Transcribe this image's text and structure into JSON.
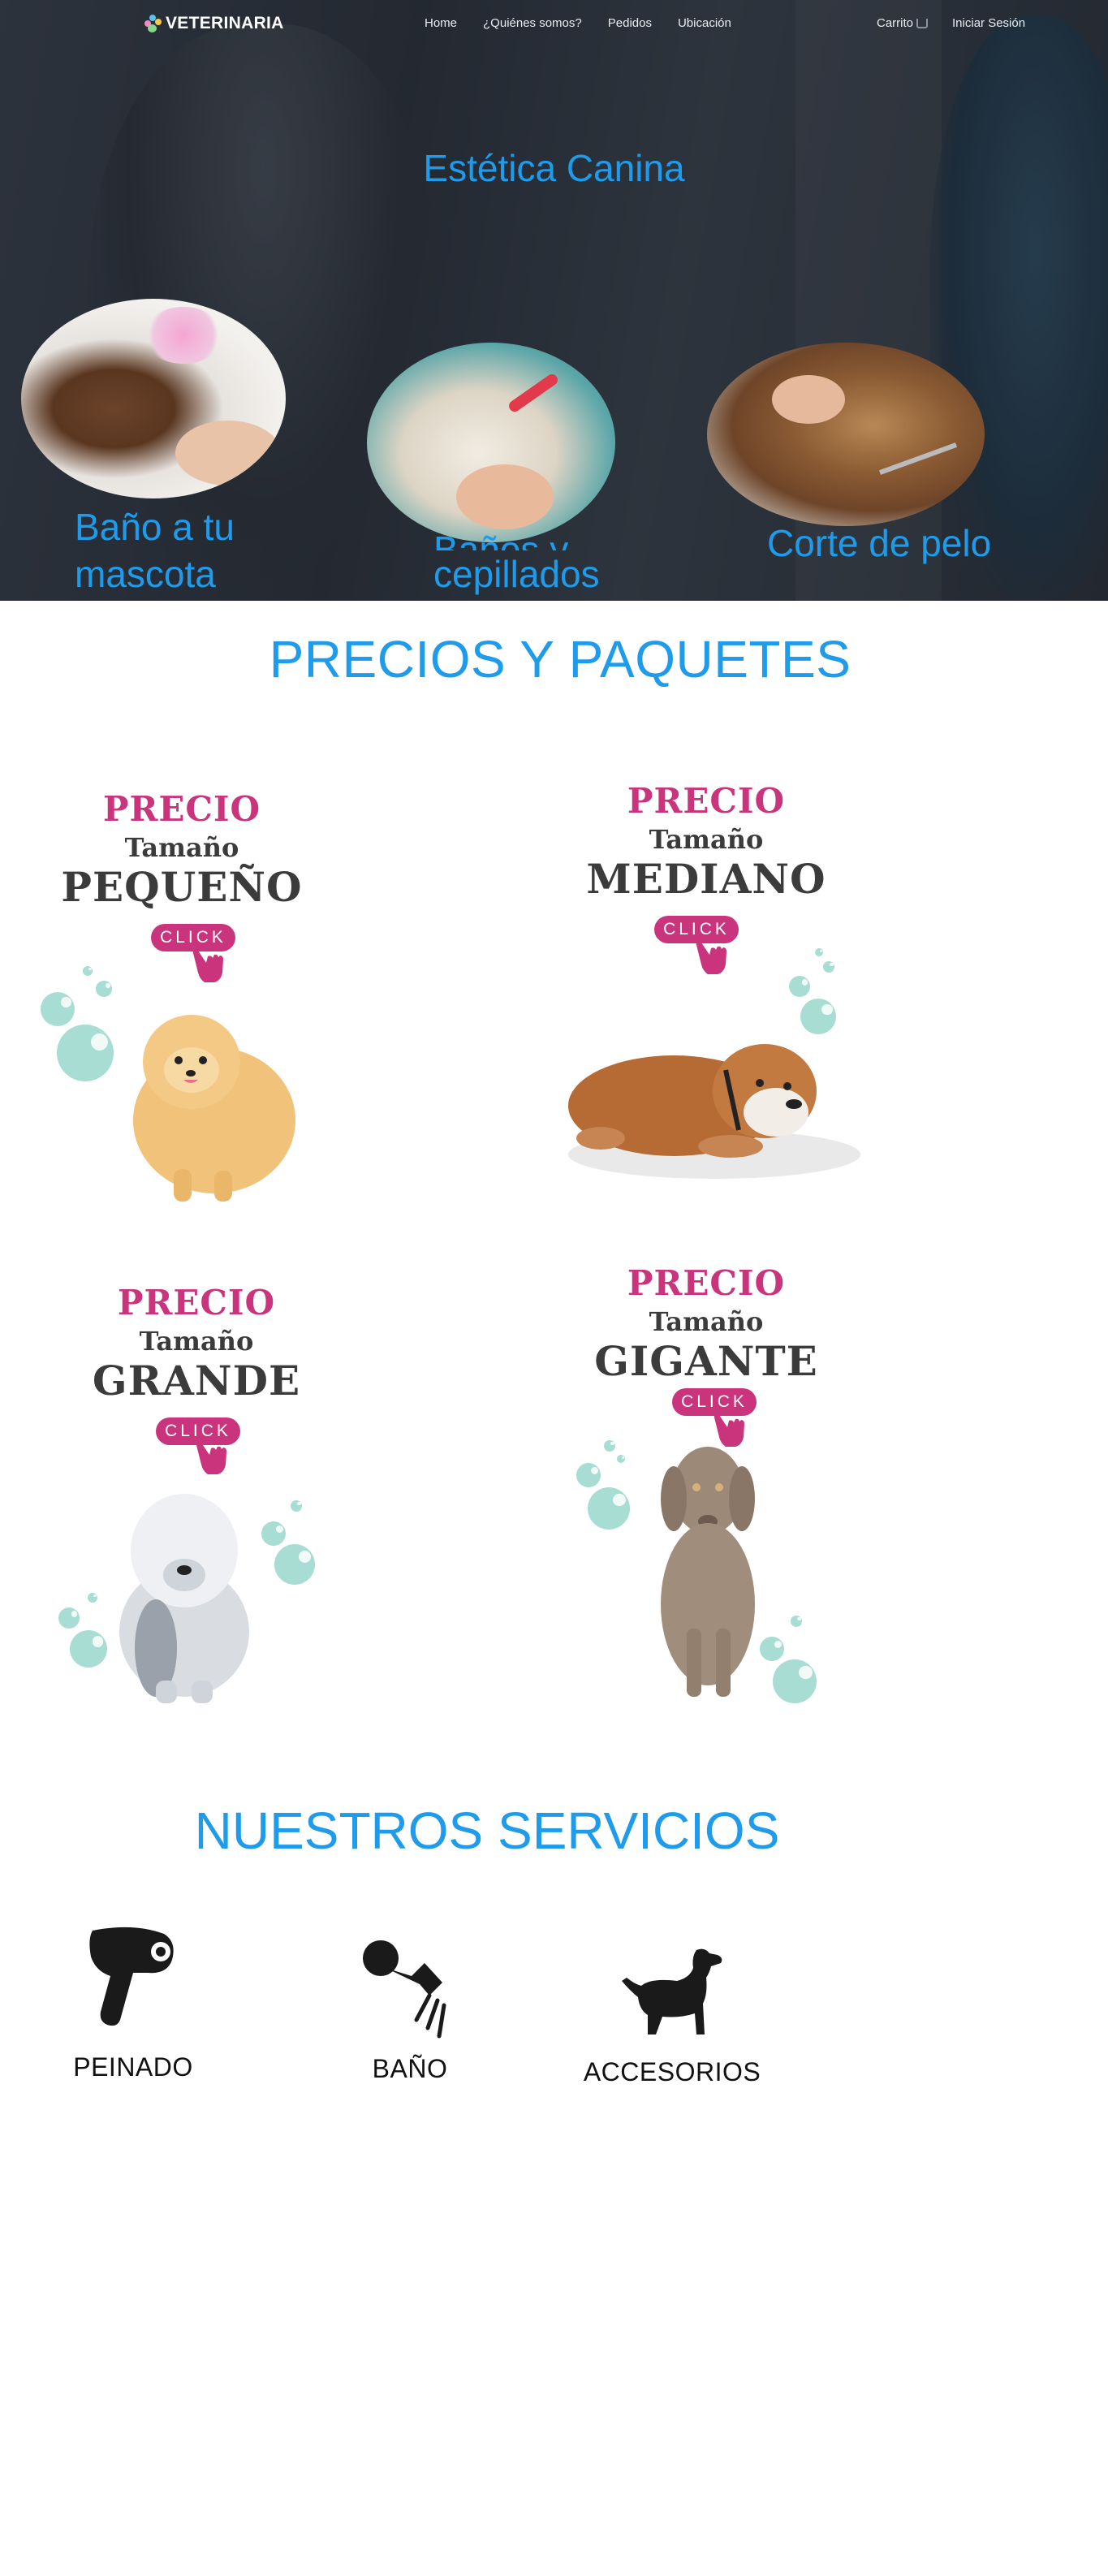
{
  "nav": {
    "brand": "VETERINARIA",
    "links": [
      "Home",
      "¿Quiénes somos?",
      "Pedidos",
      "Ubicación"
    ],
    "cart": "Carrito",
    "login": "Iniciar Sesión"
  },
  "hero": {
    "title": "Estética Canina",
    "cards": [
      {
        "label_line1": "Baño a tu",
        "label_line2": "mascota"
      },
      {
        "label_line1": "Baños y cepillados",
        "label_line2": "cepillados",
        "visible_line1": "Baños y"
      },
      {
        "label_line1": "Corte de pelo"
      }
    ]
  },
  "prices": {
    "title": "PRECIOS Y PAQUETES",
    "cards": [
      {
        "precio": "PRECIO",
        "tamano": "Tamaño",
        "size": "PEQUEÑO",
        "click": "CLICK"
      },
      {
        "precio": "PRECIO",
        "tamano": "Tamaño",
        "size": "MEDIANO",
        "click": "CLICK"
      },
      {
        "precio": "PRECIO",
        "tamano": "Tamaño",
        "size": "GRANDE",
        "click": "CLICK"
      },
      {
        "precio": "PRECIO",
        "tamano": "Tamaño",
        "size": "GIGANTE",
        "click": "CLICK"
      }
    ]
  },
  "services": {
    "title": "NUESTROS SERVICIOS",
    "items": [
      {
        "label": "PEINADO",
        "icon": "hair-dryer-icon"
      },
      {
        "label": "BAÑO",
        "icon": "shower-head-icon"
      },
      {
        "label": "ACCESORIOS",
        "icon": "dog-silhouette-icon"
      }
    ]
  },
  "colors": {
    "accent_blue": "#1e9bea",
    "accent_pink": "#c9347c",
    "bubble_teal": "#a7ddd2"
  }
}
